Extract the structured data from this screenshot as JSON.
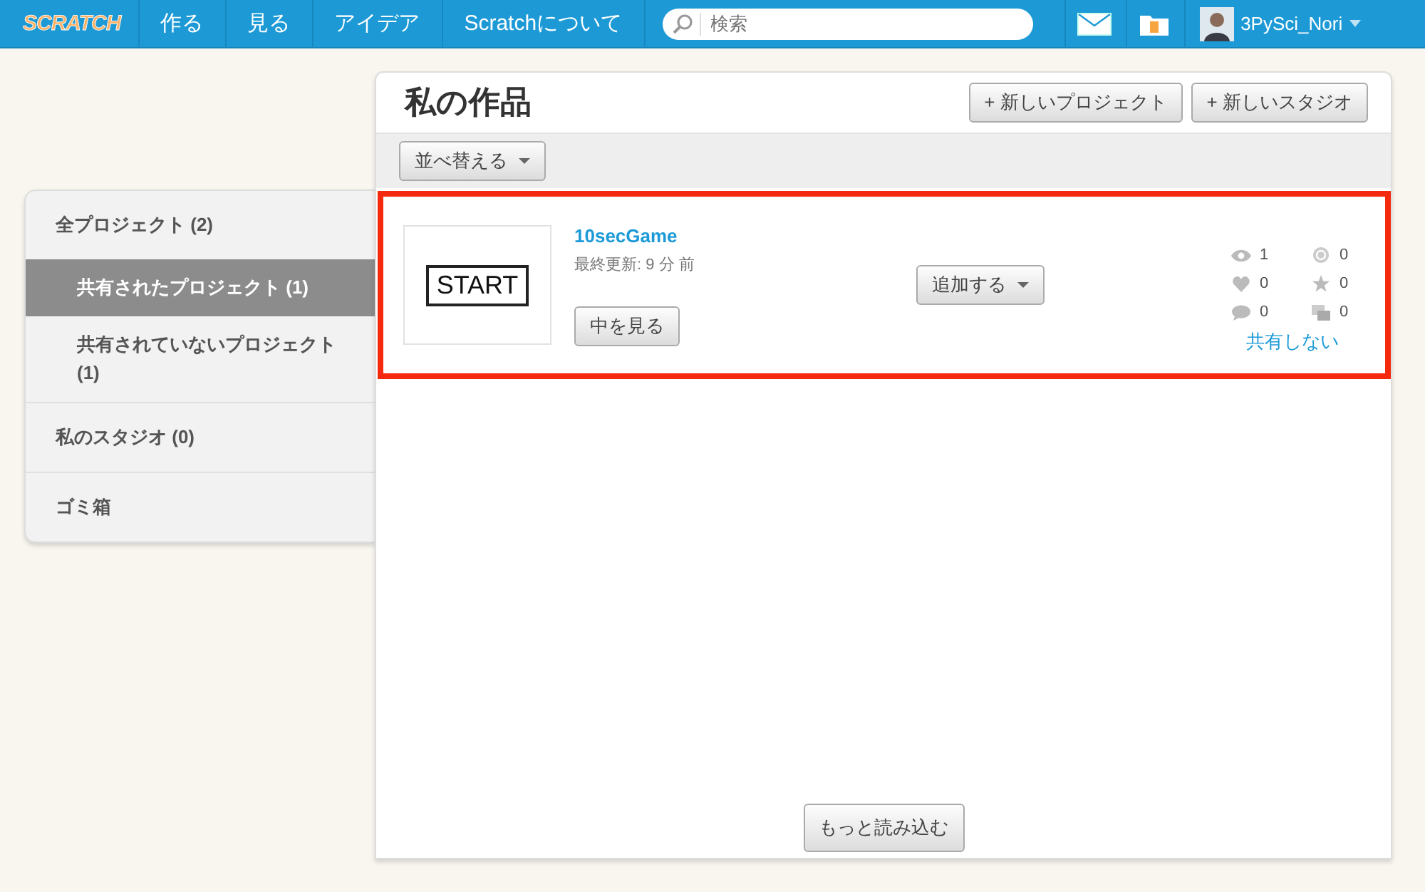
{
  "nav": {
    "logo": "SCRATCH",
    "links": [
      "作る",
      "見る",
      "アイデア",
      "Scratchについて"
    ],
    "search": {
      "placeholder": "検索"
    },
    "user": "3PySci_Nori"
  },
  "sidebar": {
    "items": [
      {
        "label": "全プロジェクト (2)",
        "selected": false,
        "children": [
          {
            "label": "共有されたプロジェクト (1)",
            "selected": true
          },
          {
            "label": "共有されていないプロジェクト (1)",
            "selected": false
          }
        ]
      },
      {
        "label": "私のスタジオ (0)",
        "selected": false
      },
      {
        "label": "ゴミ箱",
        "selected": false
      }
    ]
  },
  "main": {
    "title": "私の作品",
    "buttons": [
      "+ 新しいプロジェクト",
      "+ 新しいスタジオ"
    ],
    "sort_button": "並べ替える",
    "projects": [
      {
        "thumbnail_text": "START",
        "title": "10secGame",
        "updated": "最終更新: 9 分 前",
        "view_button": "中を見る",
        "add_button": "追加する",
        "highlighted": true,
        "stats": [
          {
            "kind": "views",
            "value": "1"
          },
          {
            "kind": "remixes",
            "value": "0"
          },
          {
            "kind": "loves",
            "value": "0"
          },
          {
            "kind": "favorites",
            "value": "0"
          },
          {
            "kind": "comments",
            "value": "0"
          },
          {
            "kind": "studios",
            "value": "0"
          }
        ],
        "unshare_link": "共有しない"
      }
    ],
    "load_more": "もっと読み込む"
  }
}
